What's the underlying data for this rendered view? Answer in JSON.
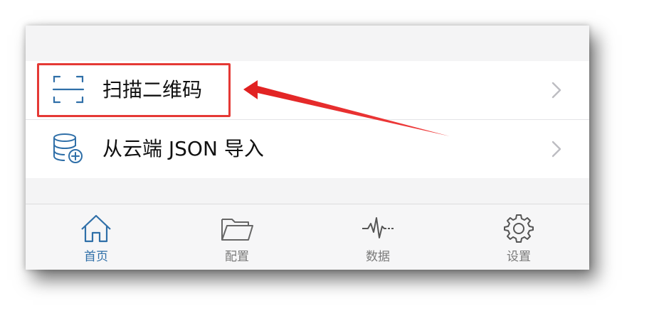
{
  "menu": {
    "items": [
      {
        "label": "扫描二维码",
        "icon": "qr-scan-icon"
      },
      {
        "label": "从云端 JSON 导入",
        "icon": "database-add-icon"
      }
    ]
  },
  "tabbar": {
    "tabs": [
      {
        "label": "首页",
        "icon": "home-icon",
        "active": true
      },
      {
        "label": "配置",
        "icon": "folder-icon",
        "active": false
      },
      {
        "label": "数据",
        "icon": "waveform-icon",
        "active": false
      },
      {
        "label": "设置",
        "icon": "gear-icon",
        "active": false
      }
    ]
  },
  "colors": {
    "accent": "#2f6fa8",
    "annotation": "#e53935",
    "inactive": "#7a7a7a",
    "background": "#f4f4f5"
  }
}
